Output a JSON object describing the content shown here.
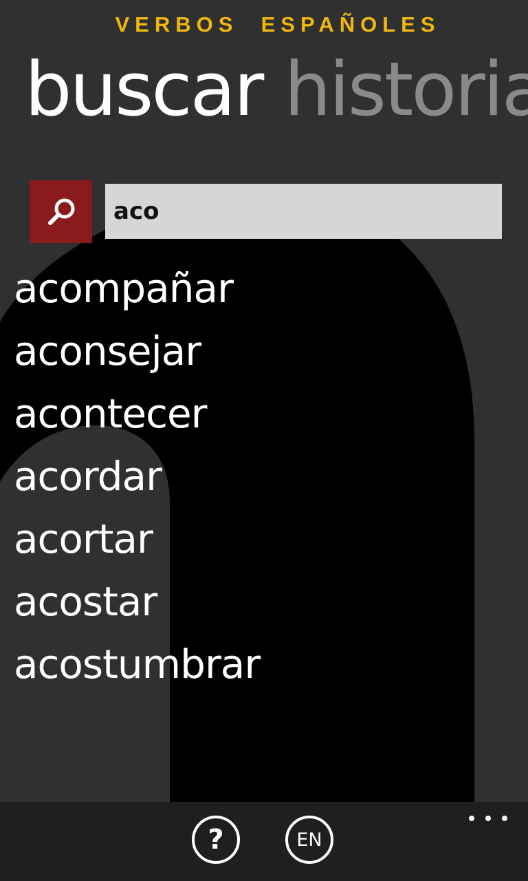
{
  "app": {
    "title": "VERBOS  ESPAÑOLES",
    "accent_color": "#f0b70d"
  },
  "pivot": {
    "items": [
      {
        "label": "buscar",
        "active": true
      },
      {
        "label": "historia",
        "active": false
      }
    ]
  },
  "search": {
    "button_icon": "search-icon",
    "button_color": "#8b1a1d",
    "value": "aco",
    "placeholder": ""
  },
  "results": [
    "acompañar",
    "aconsejar",
    "acontecer",
    "acordar",
    "acortar",
    "acostar",
    "acostumbrar"
  ],
  "app_bar": {
    "help_icon": "question-icon",
    "help_label": "?",
    "language_label": "EN",
    "more_icon": "ellipsis-icon"
  }
}
